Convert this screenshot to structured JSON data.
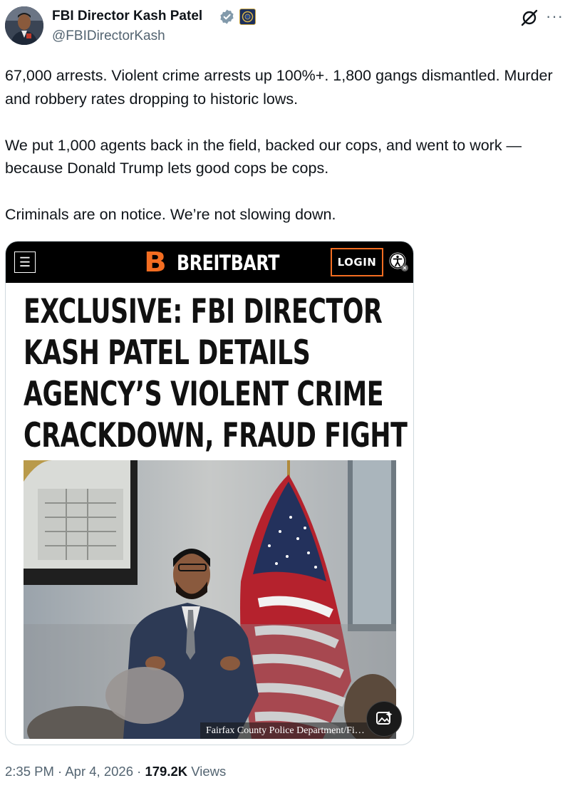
{
  "author": {
    "display_name": "FBI Director Kash Patel",
    "handle": "@FBIDirectorKash",
    "verified": true,
    "affiliation_badge": "fbi-seal-icon"
  },
  "tweet": {
    "paragraphs": [
      "67,000 arrests. Violent crime arrests up 100%+. 1,800 gangs dismantled. Murder and robbery rates dropping to historic lows.",
      "We put 1,000 agents back in the field, backed our cops, and went to work — because Donald Trump lets good cops be cops.",
      "Criminals are on notice. We’re not slowing down."
    ]
  },
  "card": {
    "site_logo_letter": "B",
    "site_name": "BREITBART",
    "login_label": "LOGIN",
    "menu_icon": "hamburger-menu-icon",
    "accessibility_icon": "accessibility-icon",
    "headline_lines": [
      "EXCLUSIVE: FBI DIRECTOR",
      "KASH PATEL DETAILS",
      "AGENCY’S VIOLENT CRIME",
      "CRACKDOWN, FRAUD FIGHT"
    ],
    "photo_credit": "Fairfax County Police Department/Fi…",
    "media_icon": "image-sparkle-icon"
  },
  "footer": {
    "time": "2:35 PM",
    "date": "Apr 4, 2026",
    "separator": "·",
    "views_count": "179.2K",
    "views_label": "Views"
  },
  "colors": {
    "breitbart_orange": "#f36d21",
    "verified_blue": "#829aab",
    "secondary_text": "#536471"
  }
}
